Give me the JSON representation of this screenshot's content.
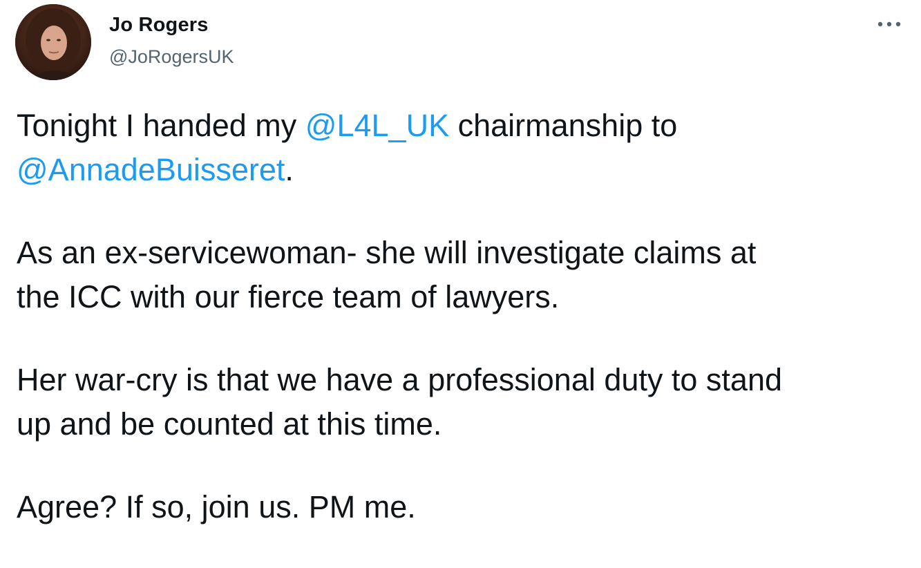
{
  "author": {
    "display_name": "Jo Rogers",
    "handle": "@JoRogersUK"
  },
  "menu": {
    "icon": "more-horizontal-icon"
  },
  "tweet": {
    "p1_before": "Tonight I handed my ",
    "p1_mention1": "@L4L_UK",
    "p1_middle": " chairmanship to",
    "p1_mention2": "@AnnadeBuisseret",
    "p1_end": ".",
    "p2_line1": "As an ex-servicewoman- she will investigate claims at",
    "p2_line2": "the ICC with our fierce team of lawyers.",
    "p3_line1": "Her war-cry is that we have a professional duty to stand",
    "p3_line2": "up and be counted at this time.",
    "p4": "Agree? If so, join us. PM me."
  },
  "colors": {
    "text": "#0f1419",
    "secondary": "#536471",
    "link": "#1d9bf0"
  }
}
